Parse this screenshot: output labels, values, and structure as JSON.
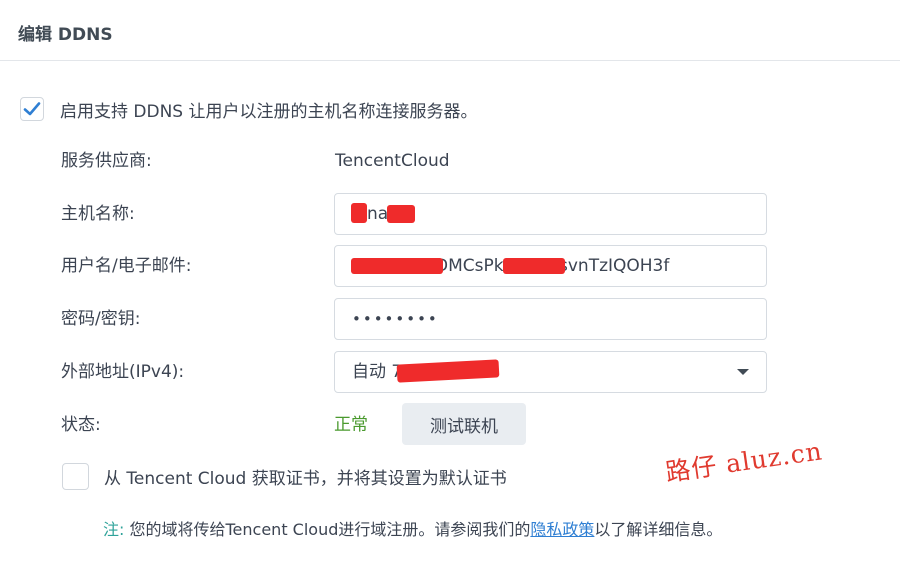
{
  "header": {
    "title": "编辑 DDNS"
  },
  "enable": {
    "checked": true,
    "label": "启用支持 DDNS 让用户以注册的主机名称连接服务器。"
  },
  "form": {
    "provider": {
      "label": "服务供应商:",
      "value": "TencentCloud"
    },
    "hostname": {
      "label": "主机名称:",
      "value": "na"
    },
    "username": {
      "label": "用户名/电子邮件:",
      "value": "DMCsPk          mbCdsvnTzIQOH3f"
    },
    "password": {
      "label": "密码/密钥:",
      "value": "••••••••"
    },
    "external_address": {
      "label": "外部地址(IPv4):",
      "value": "自动                    7.215)"
    },
    "status": {
      "label": "状态:",
      "value": "正常",
      "test_button": "测试联机"
    }
  },
  "certificate": {
    "checked": false,
    "label": "从 Tencent Cloud 获取证书，并将其设置为默认证书"
  },
  "watermark": "路仔 aluz.cn",
  "note": {
    "prefix": "注:",
    "text_before": "您的域将传给Tencent Cloud进行域注册。请参阅我们的",
    "link": "隐私政策",
    "text_after": "以了解详细信息。"
  },
  "colors": {
    "accent": "#2f7fd3",
    "status_ok": "#4a9a2e",
    "note_prefix": "#2fa39a",
    "redaction": "#ef2b2b",
    "watermark": "#e03a2f"
  }
}
